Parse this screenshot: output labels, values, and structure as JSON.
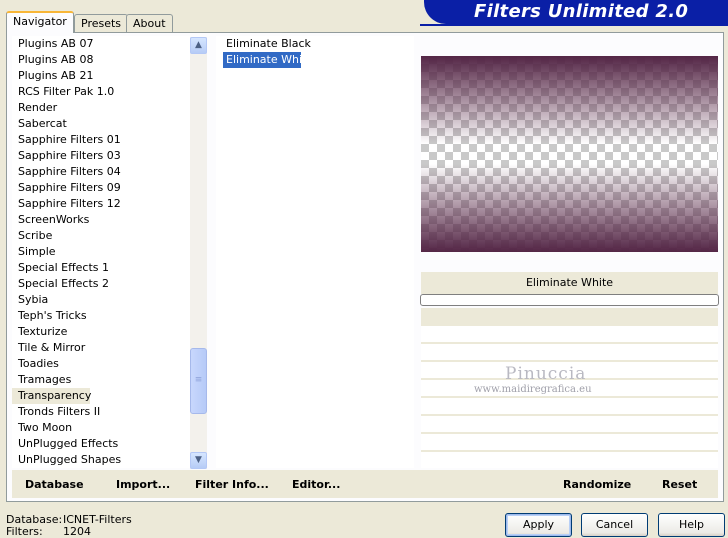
{
  "tabs": [
    "Navigator",
    "Presets",
    "About"
  ],
  "title": "Filters Unlimited 2.0",
  "categories": [
    "Plugins AB 07",
    "Plugins AB 08",
    "Plugins AB 21",
    "RCS Filter Pak 1.0",
    "Render",
    "Sabercat",
    "Sapphire Filters 01",
    "Sapphire Filters 03",
    "Sapphire Filters 04",
    "Sapphire Filters 09",
    "Sapphire Filters 12",
    "ScreenWorks",
    "Scribe",
    "Simple",
    "Special Effects 1",
    "Special Effects 2",
    "Sybia",
    "Teph's Tricks",
    "Texturize",
    "Tile & Mirror",
    "Toadies",
    "Tramages",
    "Transparency",
    "Tronds Filters II",
    "Two Moon",
    "UnPlugged Effects",
    "UnPlugged Shapes"
  ],
  "selected_category": "Transparency",
  "filters": [
    "Eliminate Black",
    "Eliminate White"
  ],
  "selected_filter": "Eliminate White",
  "filter_caption": "Eliminate White",
  "watermark": {
    "name": "Pinuccia",
    "site": "www.maidiregrafica.eu"
  },
  "bottom_links": {
    "database": "Database",
    "import": "Import...",
    "filter_info": "Filter Info...",
    "editor": "Editor...",
    "randomize": "Randomize",
    "reset": "Reset"
  },
  "status": {
    "database_label": "Database:",
    "database_value": "ICNET-Filters",
    "filters_label": "Filters:",
    "filters_value": "1204"
  },
  "buttons": {
    "apply": "Apply",
    "cancel": "Cancel",
    "help": "Help"
  },
  "colors": {
    "banner": "#0A1FA6",
    "selection": "#316AC5",
    "preview_tint": "#542646"
  },
  "icons": {
    "scroll_up": "▲",
    "scroll_down": "▼",
    "grip": "≡"
  }
}
